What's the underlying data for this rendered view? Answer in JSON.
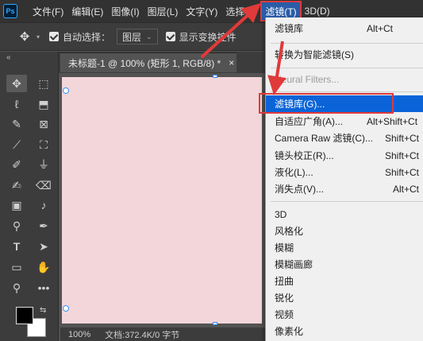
{
  "app": {
    "logo": "Ps"
  },
  "menubar": {
    "items": [
      {
        "label": "文件(F)"
      },
      {
        "label": "编辑(E)"
      },
      {
        "label": "图像(I)"
      },
      {
        "label": "图层(L)"
      },
      {
        "label": "文字(Y)"
      },
      {
        "label": "选择(S)"
      },
      {
        "label": "滤镜(T)"
      },
      {
        "label": "3D(D)"
      }
    ]
  },
  "options": {
    "auto_select_label": "自动选择：",
    "auto_select_value": "图层",
    "show_transform_label": "显示变换控件"
  },
  "document": {
    "tab_title": "未标题-1 @ 100% (矩形 1, RGB/8) *",
    "close_glyph": "×",
    "zoom": "100%",
    "doc_info": "文档:372.4K/0 字节"
  },
  "filter_menu": {
    "items": [
      {
        "label": "滤镜库",
        "shortcut": "Alt+Ct"
      },
      {
        "label": "转换为智能滤镜(S)",
        "shortcut": ""
      },
      {
        "label": "Neural Filters...",
        "shortcut": "",
        "disabled": true
      },
      {
        "label": "滤镜库(G)...",
        "shortcut": "",
        "highlight": true
      },
      {
        "label": "自适应广角(A)...",
        "shortcut": "Alt+Shift+Ct"
      },
      {
        "label": "Camera Raw 滤镜(C)...",
        "shortcut": "Shift+Ct"
      },
      {
        "label": "镜头校正(R)...",
        "shortcut": "Shift+Ct"
      },
      {
        "label": "液化(L)...",
        "shortcut": "Shift+Ct"
      },
      {
        "label": "消失点(V)...",
        "shortcut": "Alt+Ct"
      },
      {
        "label": "3D",
        "shortcut": ""
      },
      {
        "label": "风格化",
        "shortcut": ""
      },
      {
        "label": "模糊",
        "shortcut": ""
      },
      {
        "label": "模糊画廊",
        "shortcut": ""
      },
      {
        "label": "扭曲",
        "shortcut": ""
      },
      {
        "label": "锐化",
        "shortcut": ""
      },
      {
        "label": "视频",
        "shortcut": ""
      },
      {
        "label": "像素化",
        "shortcut": ""
      }
    ]
  },
  "colors": {
    "accent_highlight": "#0a64d8",
    "annotation_red": "#e03a3a",
    "canvas_fill": "#f3d6da"
  },
  "toolbar": {
    "icons": [
      "move-tool-icon",
      "marquee-tool-icon",
      "lasso-tool-icon",
      "object-select-tool-icon",
      "crop-tool-icon",
      "frame-tool-icon",
      "eyedropper-tool-icon",
      "spot-healing-icon",
      "brush-tool-icon",
      "clone-stamp-icon",
      "history-brush-icon",
      "eraser-tool-icon",
      "gradient-tool-icon",
      "blur-tool-icon",
      "dodge-tool-icon",
      "pen-tool-icon",
      "type-tool-icon",
      "path-select-icon",
      "rectangle-tool-icon",
      "hand-tool-icon",
      "zoom-tool-icon",
      "more-tools-icon"
    ]
  }
}
